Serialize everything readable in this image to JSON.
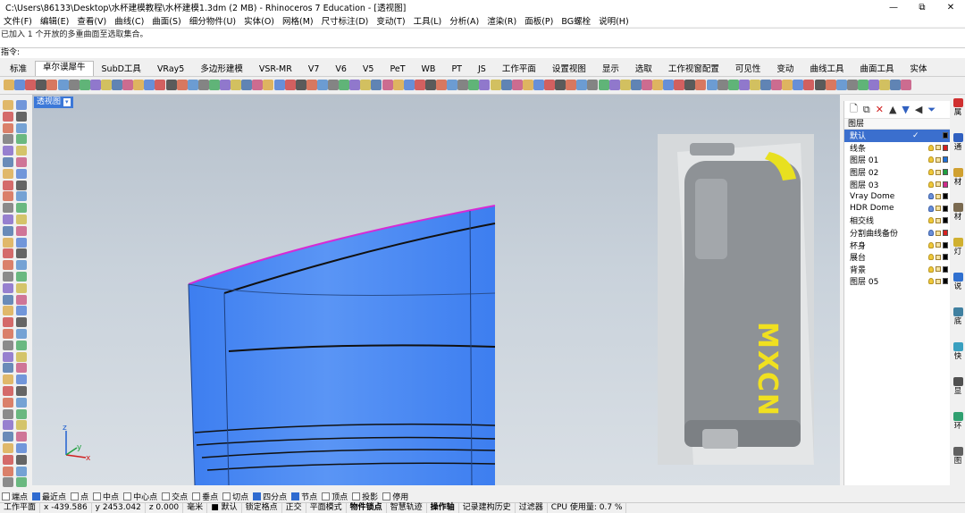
{
  "window": {
    "title": "C:\\Users\\86133\\Desktop\\水杯建模教程\\水杯建模1.3dm (2 MB) - Rhinoceros 7 Education - [透视图]",
    "min": "—",
    "restore": "⧉",
    "close": "✕"
  },
  "menu": [
    "文件(F)",
    "编辑(E)",
    "查看(V)",
    "曲线(C)",
    "曲面(S)",
    "细分物件(U)",
    "实体(O)",
    "网格(M)",
    "尺寸标注(D)",
    "变动(T)",
    "工具(L)",
    "分析(A)",
    "渲染(R)",
    "面板(P)",
    "BG螺栓",
    "说明(H)"
  ],
  "command": {
    "history": "已加入 1 个开放的多重曲面至选取集合。",
    "prompt": "指令:"
  },
  "tabs": [
    "标准",
    "卓尔谟犀牛",
    "SubD工具",
    "VRay5",
    "多边形建模",
    "VSR-MR",
    "V7",
    "V6",
    "V5",
    "PeT",
    "WB",
    "PT",
    "JS",
    "工作平面",
    "设置视图",
    "显示",
    "选取",
    "工作视窗配置",
    "可见性",
    "变动",
    "曲线工具",
    "曲面工具",
    "实体"
  ],
  "active_tab": "卓尔谟犀牛",
  "viewport": {
    "label": "透视图",
    "arrow": "▾",
    "render_text": "MXCN",
    "axis_x": "x",
    "axis_y": "y",
    "axis_z": "z"
  },
  "layers": {
    "header": "图层",
    "rows": [
      {
        "name": "默认",
        "color": "#000000",
        "selected": true,
        "check": "✓",
        "bulb": "y"
      },
      {
        "name": "线条",
        "color": "#d62020",
        "bulb": "y"
      },
      {
        "name": "图层 01",
        "color": "#1e6fd6",
        "bulb": "y"
      },
      {
        "name": "图层 02",
        "color": "#20a040",
        "bulb": "y"
      },
      {
        "name": "图层 03",
        "color": "#d02c8a",
        "bulb": "y"
      },
      {
        "name": "Vray Dome",
        "color": "#000000",
        "bulb": "b"
      },
      {
        "name": "HDR Dome",
        "color": "#000000",
        "bulb": "b"
      },
      {
        "name": "相交线",
        "color": "#000000",
        "bulb": "y"
      },
      {
        "name": "分割曲线备份",
        "color": "#d62020",
        "bulb": "b"
      },
      {
        "name": "杯身",
        "color": "#000000",
        "bulb": "y"
      },
      {
        "name": "展台",
        "color": "#000000",
        "bulb": "y"
      },
      {
        "name": "背景",
        "color": "#000000",
        "bulb": "y"
      },
      {
        "name": "图层 05",
        "color": "#000000",
        "bulb": "y"
      }
    ]
  },
  "right_tabs": [
    "属",
    "通",
    "材",
    "材",
    "灯",
    "说",
    "底",
    "快",
    "显",
    "环",
    "图"
  ],
  "osnaps": [
    {
      "label": "端点",
      "on": false
    },
    {
      "label": "最近点",
      "on": true
    },
    {
      "label": "点",
      "on": false
    },
    {
      "label": "中点",
      "on": false
    },
    {
      "label": "中心点",
      "on": false
    },
    {
      "label": "交点",
      "on": false
    },
    {
      "label": "垂点",
      "on": false
    },
    {
      "label": "切点",
      "on": false
    },
    {
      "label": "四分点",
      "on": true
    },
    {
      "label": "节点",
      "on": true
    },
    {
      "label": "顶点",
      "on": false
    },
    {
      "label": "投影",
      "on": false
    },
    {
      "label": "停用",
      "on": false
    }
  ],
  "status": {
    "cplane": "工作平面",
    "x": "x -439.586",
    "y": "y 2453.042",
    "z": "z 0.000",
    "units": "毫米",
    "layer": "默认",
    "items": [
      "锁定格点",
      "正交",
      "平面模式",
      "物件锁点",
      "智慧轨迹",
      "操作轴",
      "记录建构历史",
      "过滤器",
      "CPU 使用量: 0.7 %"
    ],
    "bold": [
      "物件锁点",
      "操作轴"
    ]
  }
}
